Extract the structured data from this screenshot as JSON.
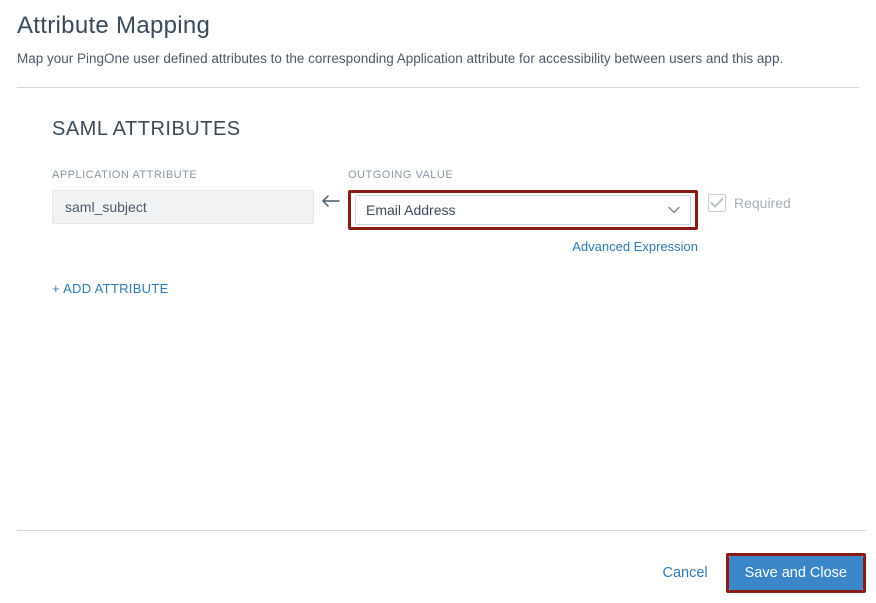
{
  "header": {
    "title": "Attribute Mapping",
    "description": "Map your PingOne user defined attributes to the corresponding Application attribute for accessibility between users and this app."
  },
  "section": {
    "title": "SAML ATTRIBUTES",
    "columns": {
      "application_attribute": "APPLICATION ATTRIBUTE",
      "outgoing_value": "OUTGOING VALUE"
    }
  },
  "row": {
    "application_attribute_value": "saml_subject",
    "outgoing_value_selected": "Email Address",
    "advanced_expression_link": "Advanced Expression",
    "required_label": "Required",
    "required_checked": true
  },
  "actions": {
    "add_attribute": "+ ADD ATTRIBUTE",
    "cancel": "Cancel",
    "save": "Save and Close"
  },
  "colors": {
    "highlight_border": "#8c1c13",
    "primary_button": "#3a86c8",
    "link": "#2f7ab5"
  }
}
